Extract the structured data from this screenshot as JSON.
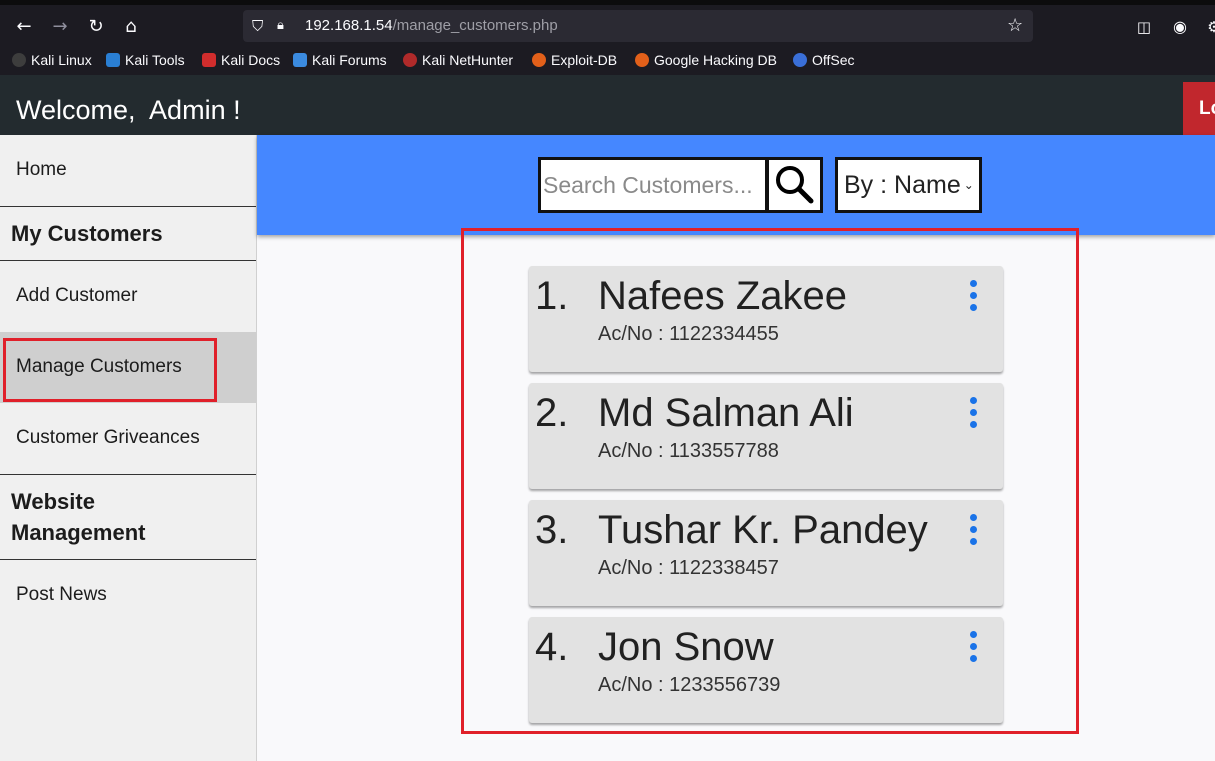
{
  "browser": {
    "url_host": "192.168.1.54",
    "url_path": "/manage_customers.php",
    "bookmarks": [
      "Kali Linux",
      "Kali Tools",
      "Kali Docs",
      "Kali Forums",
      "Kali NetHunter",
      "Exploit-DB",
      "Google Hacking DB",
      "OffSec"
    ]
  },
  "header": {
    "welcome": "Welcome,  Admin !",
    "logout_label": "Lo"
  },
  "sidebar": {
    "home": "Home",
    "section_customers": "My Customers",
    "add_customer": "Add Customer",
    "manage_customers": "Manage Customers",
    "griveances": "Customer Griveances",
    "section_website": "Website Management",
    "post_news": "Post News"
  },
  "search": {
    "placeholder": "Search Customers...",
    "filter_label": "By :",
    "filter_value": "Name"
  },
  "customers": [
    {
      "num": "1.",
      "name": "Nafees Zakee",
      "acc": "Ac/No : 1122334455"
    },
    {
      "num": "2.",
      "name": "Md Salman Ali",
      "acc": "Ac/No : 1133557788"
    },
    {
      "num": "3.",
      "name": "Tushar Kr. Pandey",
      "acc": "Ac/No : 1122338457"
    },
    {
      "num": "4.",
      "name": "Jon Snow",
      "acc": "Ac/No : 1233556739"
    }
  ],
  "colors": {
    "header_bg": "#232b2f",
    "search_band": "#4587ff",
    "logout_bg": "#c1272d",
    "highlight_box": "#e0202a",
    "menu_dots": "#1a73e8"
  }
}
